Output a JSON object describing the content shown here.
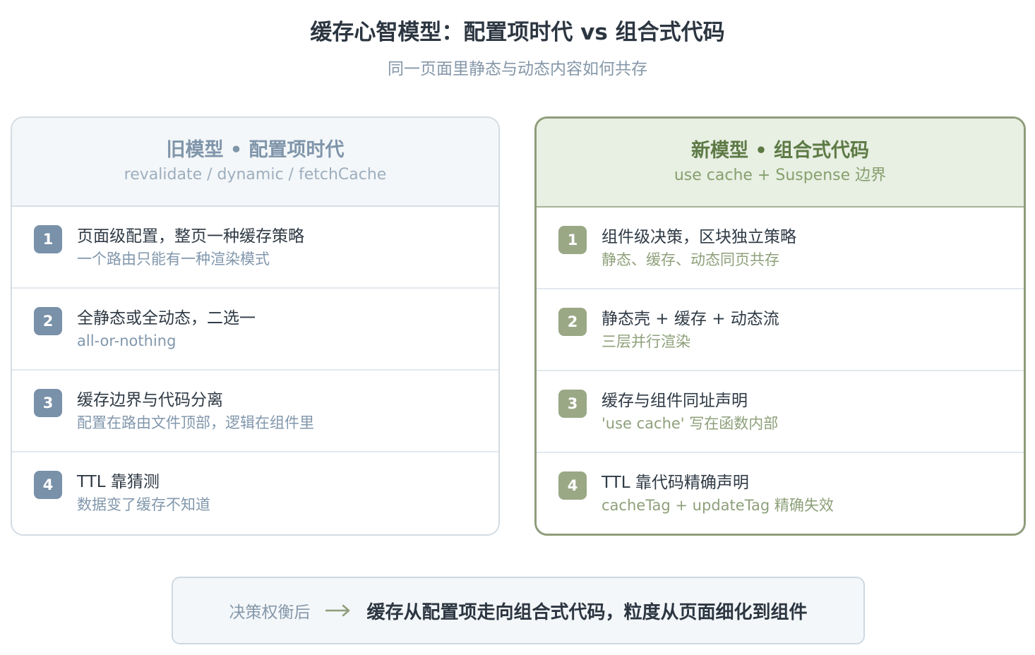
{
  "header": {
    "title": "缓存心智模型：配置项时代 vs 组合式代码",
    "subtitle": "同一页面里静态与动态内容如何共存"
  },
  "old_model": {
    "title": "旧模型 • 配置项时代",
    "subtitle": "revalidate / dynamic / fetchCache",
    "items": [
      {
        "num": "1",
        "main": "页面级配置，整页一种缓存策略",
        "sub": "一个路由只能有一种渲染模式"
      },
      {
        "num": "2",
        "main": "全静态或全动态，二选一",
        "sub": "all-or-nothing"
      },
      {
        "num": "3",
        "main": "缓存边界与代码分离",
        "sub": "配置在路由文件顶部，逻辑在组件里"
      },
      {
        "num": "4",
        "main": "TTL 靠猜测",
        "sub": "数据变了缓存不知道"
      }
    ]
  },
  "new_model": {
    "title": "新模型 • 组合式代码",
    "subtitle": "use cache + Suspense 边界",
    "items": [
      {
        "num": "1",
        "main": "组件级决策，区块独立策略",
        "sub": "静态、缓存、动态同页共存"
      },
      {
        "num": "2",
        "main": "静态壳 + 缓存 + 动态流",
        "sub": "三层并行渲染"
      },
      {
        "num": "3",
        "main": "缓存与组件同址声明",
        "sub": "'use cache' 写在函数内部"
      },
      {
        "num": "4",
        "main": "TTL 靠代码精确声明",
        "sub": "cacheTag + updateTag 精确失效"
      }
    ]
  },
  "conclusion": {
    "label": "决策权衡后",
    "arrow_icon": "arrow-right-icon",
    "text": "缓存从配置项走向组合式代码，粒度从页面细化到组件"
  },
  "colors": {
    "old_accent": "#7991a9",
    "new_accent": "#9aa886",
    "new_border": "#8f9d7b"
  }
}
